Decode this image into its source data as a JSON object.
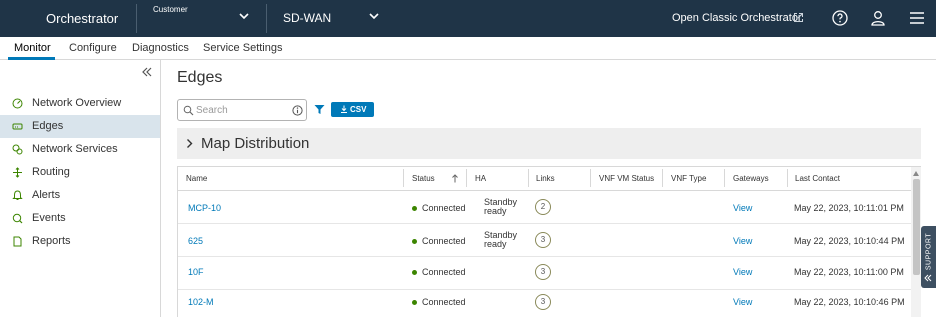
{
  "header": {
    "brand": "Orchestrator",
    "customer_label": "Customer",
    "product": "SD-WAN",
    "classic_link": "Open Classic Orchestrator",
    "icons": [
      "chevron-down-icon",
      "external-link-icon",
      "help-icon",
      "user-icon",
      "menu-icon"
    ]
  },
  "nav": {
    "tabs": [
      {
        "label": "Monitor",
        "active": true
      },
      {
        "label": "Configure"
      },
      {
        "label": "Diagnostics"
      },
      {
        "label": "Service Settings"
      }
    ]
  },
  "sidebar": {
    "items": [
      {
        "label": "Network Overview",
        "icon": "gauge-icon"
      },
      {
        "label": "Edges",
        "icon": "edge-device-icon",
        "active": true
      },
      {
        "label": "Network Services",
        "icon": "network-services-icon"
      },
      {
        "label": "Routing",
        "icon": "routing-icon"
      },
      {
        "label": "Alerts",
        "icon": "alert-icon"
      },
      {
        "label": "Events",
        "icon": "events-icon"
      },
      {
        "label": "Reports",
        "icon": "report-icon"
      }
    ]
  },
  "main": {
    "title": "Edges",
    "search_placeholder": "Search",
    "csv_label": "CSV",
    "map_distribution": "Map Distribution"
  },
  "table": {
    "columns": [
      "Name",
      "Status",
      "HA",
      "Links",
      "VNF VM Status",
      "VNF Type",
      "Gateways",
      "Last Contact"
    ],
    "sort_column": "Status",
    "rows": [
      {
        "name": "MCP-10",
        "status": "Connected",
        "ha_1": "Standby",
        "ha_2": "ready",
        "links": "2",
        "gateways": "View",
        "last_contact": "May 22, 2023, 10:11:01 PM"
      },
      {
        "name": "625",
        "status": "Connected",
        "ha_1": "Standby",
        "ha_2": "ready",
        "links": "3",
        "gateways": "View",
        "last_contact": "May 22, 2023, 10:10:44 PM"
      },
      {
        "name": "10F",
        "status": "Connected",
        "ha_1": "",
        "ha_2": "",
        "links": "3",
        "gateways": "View",
        "last_contact": "May 22, 2023, 10:11:00 PM"
      },
      {
        "name": "102-M",
        "status": "Connected",
        "ha_1": "",
        "ha_2": "",
        "links": "3",
        "gateways": "View",
        "last_contact": "May 22, 2023, 10:10:46 PM"
      }
    ]
  },
  "support_tab": "SUPPORT",
  "colors": {
    "header_bg": "#1f3447",
    "accent": "#0079b8",
    "connected": "#3c8500",
    "active_sidebar": "#d9e4ec"
  }
}
